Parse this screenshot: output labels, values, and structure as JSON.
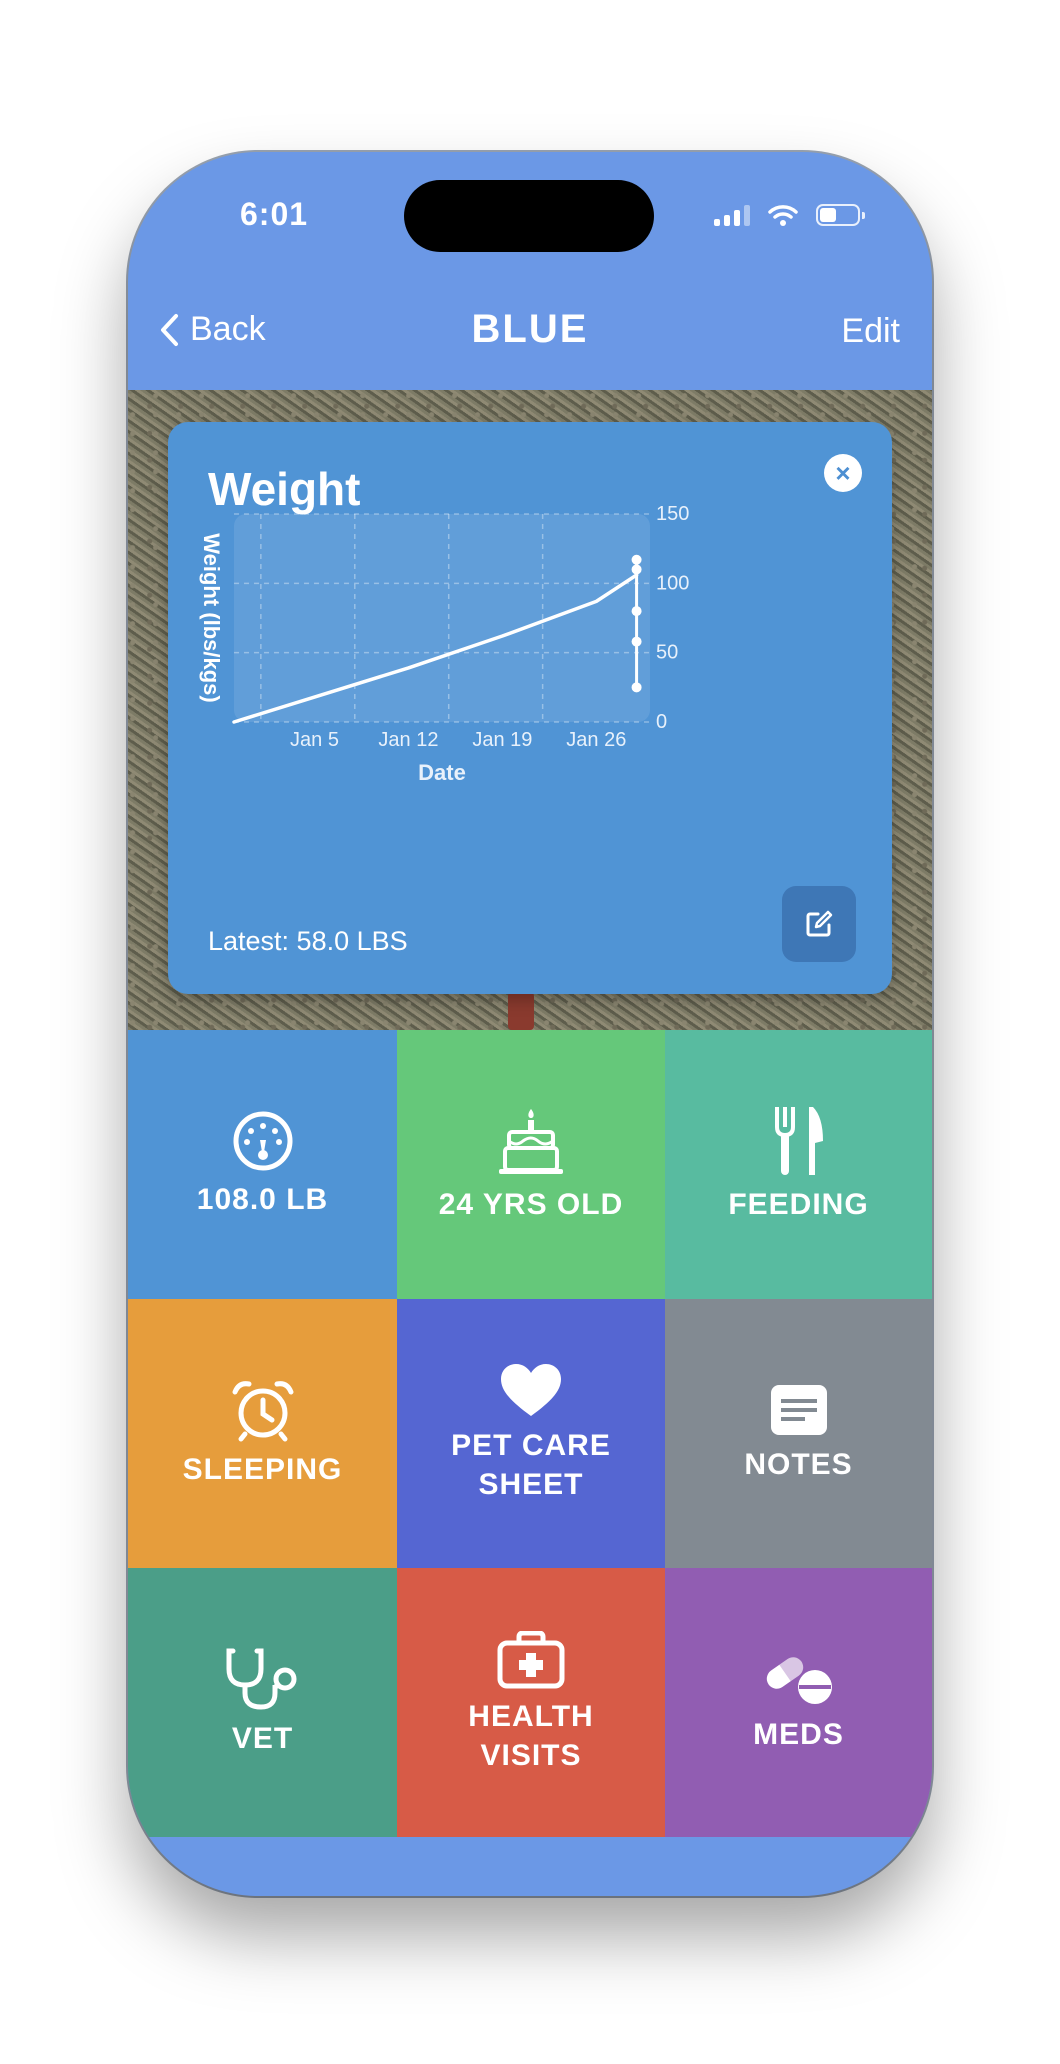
{
  "status_bar": {
    "time": "6:01"
  },
  "nav": {
    "back_label": "Back",
    "title": "BLUE",
    "edit_label": "Edit"
  },
  "weight_card": {
    "title": "Weight",
    "latest": "Latest: 58.0 LBS"
  },
  "chart_data": {
    "type": "line",
    "title": "Weight",
    "xlabel": "Date",
    "ylabel": "Weight (lbs/kgs)",
    "x_ticks": [
      "Jan 5",
      "Jan 12",
      "Jan 19",
      "Jan 26"
    ],
    "y_ticks": [
      "150",
      "100",
      "50",
      "0"
    ],
    "ylim": [
      0,
      150
    ],
    "xlim": [
      "2025-12-30",
      "2026-01-30"
    ],
    "grid": true,
    "series": [
      {
        "x": [
          "2025-12-30",
          "2026-01-05",
          "2026-01-12",
          "2026-01-19",
          "2026-01-26",
          "2026-01-29"
        ],
        "y": [
          0,
          18,
          39,
          62,
          87,
          106
        ]
      }
    ],
    "extra_points_y": [
      117,
      110,
      80,
      58,
      25
    ]
  },
  "tiles": [
    {
      "key": "weight",
      "label": "108.0 LB",
      "icon": "gauge-icon",
      "color": "#5094d5"
    },
    {
      "key": "age",
      "label": "24 YRS OLD",
      "icon": "birthday-cake-icon",
      "color": "#65c87a"
    },
    {
      "key": "feeding",
      "label": "FEEDING",
      "icon": "fork-knife-icon",
      "color": "#58bba0"
    },
    {
      "key": "sleeping",
      "label": "SLEEPING",
      "icon": "alarm-clock-icon",
      "color": "#e69d3c"
    },
    {
      "key": "pet_care_sheet",
      "label": "PET CARE\nSHEET",
      "icon": "heart-icon",
      "color": "#5566d2"
    },
    {
      "key": "notes",
      "label": "NOTES",
      "icon": "note-icon",
      "color": "#828a92"
    },
    {
      "key": "vet",
      "label": "VET",
      "icon": "stethoscope-icon",
      "color": "#4b9e88"
    },
    {
      "key": "health_visits",
      "label": "HEALTH\nVISITS",
      "icon": "medical-kit-icon",
      "color": "#d75b47"
    },
    {
      "key": "meds",
      "label": "MEDS",
      "icon": "pills-icon",
      "color": "#915db2"
    }
  ]
}
